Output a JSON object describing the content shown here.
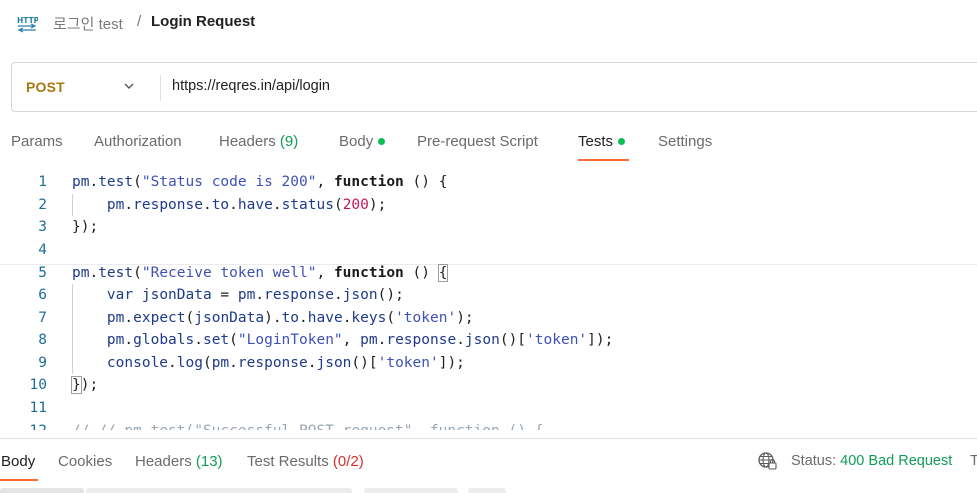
{
  "header": {
    "icon": "http-icon",
    "breadcrumb_parent": "로그인 test",
    "breadcrumb_separator": "/",
    "breadcrumb_current": "Login Request"
  },
  "request": {
    "method": "POST",
    "method_color": "#a9780f",
    "url": "https://reqres.in/api/login"
  },
  "tabs": {
    "params": "Params",
    "authorization": "Authorization",
    "headers": "Headers",
    "headers_count": "(9)",
    "body": "Body",
    "prerequest": "Pre-request Script",
    "tests": "Tests",
    "settings": "Settings",
    "active": "Tests",
    "accent_color": "#ff6c37",
    "dot_color": "#0cbb52"
  },
  "editor": {
    "line_numbers": [
      "1",
      "2",
      "3",
      "4",
      "5",
      "6",
      "7",
      "8",
      "9",
      "10",
      "11",
      "12"
    ]
  },
  "response": {
    "body": "Body",
    "cookies": "Cookies",
    "headers": "Headers",
    "headers_count": "(13)",
    "test_results": "Test Results",
    "test_results_count": "(0/2)",
    "status_label": "Status:",
    "status_value": "400 Bad Request",
    "time_fragment": "T"
  }
}
